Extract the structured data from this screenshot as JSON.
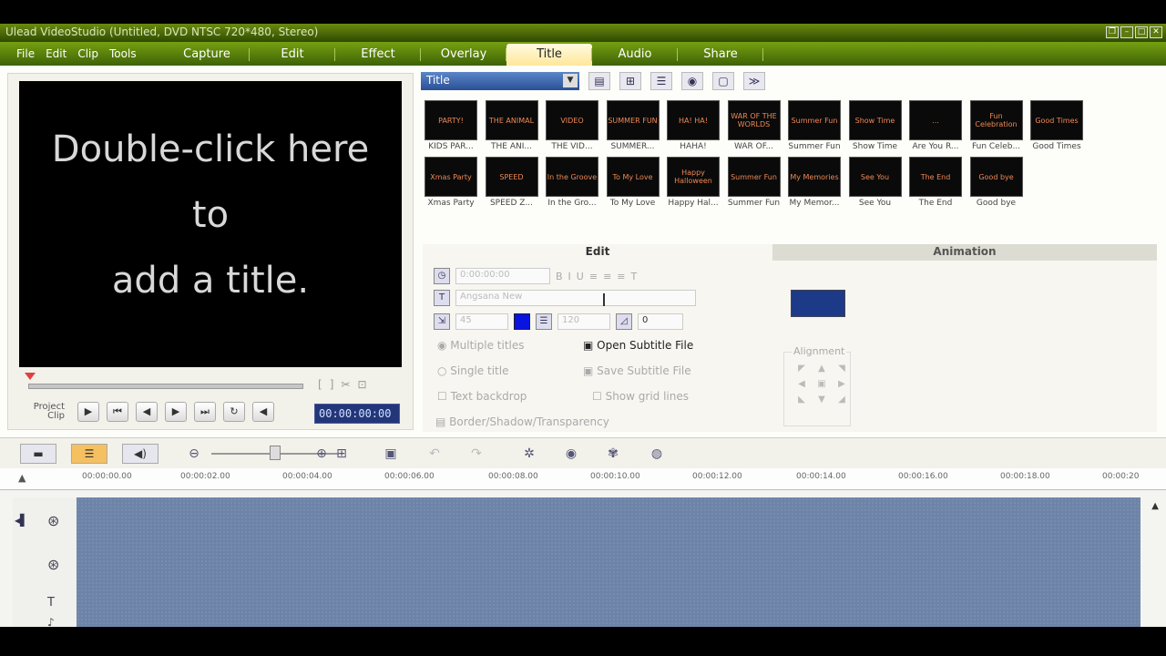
{
  "window_title": "Ulead VideoStudio (Untitled, DVD NTSC 720*480, Stereo)",
  "menu": [
    "File",
    "Edit",
    "Clip",
    "Tools"
  ],
  "steps": [
    "Capture",
    "Edit",
    "Effect",
    "Overlay",
    "Title",
    "Audio",
    "Share"
  ],
  "active_step": "Title",
  "preview": {
    "line1": "Double-click here",
    "line2": "to",
    "line3": "add a title.",
    "mode_project": "Project",
    "mode_clip": "Clip",
    "timecode": "00:00:00:00"
  },
  "library": {
    "category": "Title",
    "thumbnails": [
      {
        "label": "KIDS PAR...",
        "art": "PARTY!"
      },
      {
        "label": "THE ANI...",
        "art": "THE ANIMAL"
      },
      {
        "label": "THE VID...",
        "art": "VIDEO"
      },
      {
        "label": "SUMMER...",
        "art": "SUMMER FUN"
      },
      {
        "label": "HAHA!",
        "art": "HA! HA!"
      },
      {
        "label": "WAR OF...",
        "art": "WAR OF THE WORLDS"
      },
      {
        "label": "Summer Fun",
        "art": "Summer Fun"
      },
      {
        "label": "Show Time",
        "art": "Show Time"
      },
      {
        "label": "Are You R...",
        "art": "..."
      },
      {
        "label": "Fun Celeb...",
        "art": "Fun Celebration"
      },
      {
        "label": "Good Times",
        "art": "Good Times"
      },
      {
        "label": "Xmas Party",
        "art": "Xmas Party"
      },
      {
        "label": "SPEED Z...",
        "art": "SPEED"
      },
      {
        "label": "In the Gro...",
        "art": "In the Groove"
      },
      {
        "label": "To My Love",
        "art": "To My Love"
      },
      {
        "label": "Happy Hal...",
        "art": "Happy Halloween"
      },
      {
        "label": "Summer Fun",
        "art": "Summer Fun"
      },
      {
        "label": "My Memor...",
        "art": "My Memories"
      },
      {
        "label": "See You",
        "art": "See You"
      },
      {
        "label": "The End",
        "art": "The End"
      },
      {
        "label": "Good bye",
        "art": "Good bye"
      }
    ]
  },
  "options": {
    "tab_edit": "Edit",
    "tab_animation": "Animation",
    "font_name": "Angsana New",
    "font_size": "45",
    "line_spacing": "120",
    "angle": "0",
    "multiple_titles": "Multiple titles",
    "single_title": "Single title",
    "text_backdrop": "Text backdrop",
    "show_grid_lines": "Show grid lines",
    "open_subtitle": "Open Subtitle File",
    "save_subtitle": "Save Subtitle File",
    "border_shadow": "Border/Shadow/Transparency",
    "alignment": "Alignment"
  },
  "ruler": [
    "00:00:00.00",
    "00:00:02.00",
    "00:00:04.00",
    "00:00:06.00",
    "00:00:08.00",
    "00:00:10.00",
    "00:00:12.00",
    "00:00:14.00",
    "00:00:16.00",
    "00:00:18.00",
    "00:00:20"
  ],
  "colors": {
    "accent_green": "#5c860c",
    "title_color": "#0a14e0",
    "track": "#6d84a8"
  }
}
